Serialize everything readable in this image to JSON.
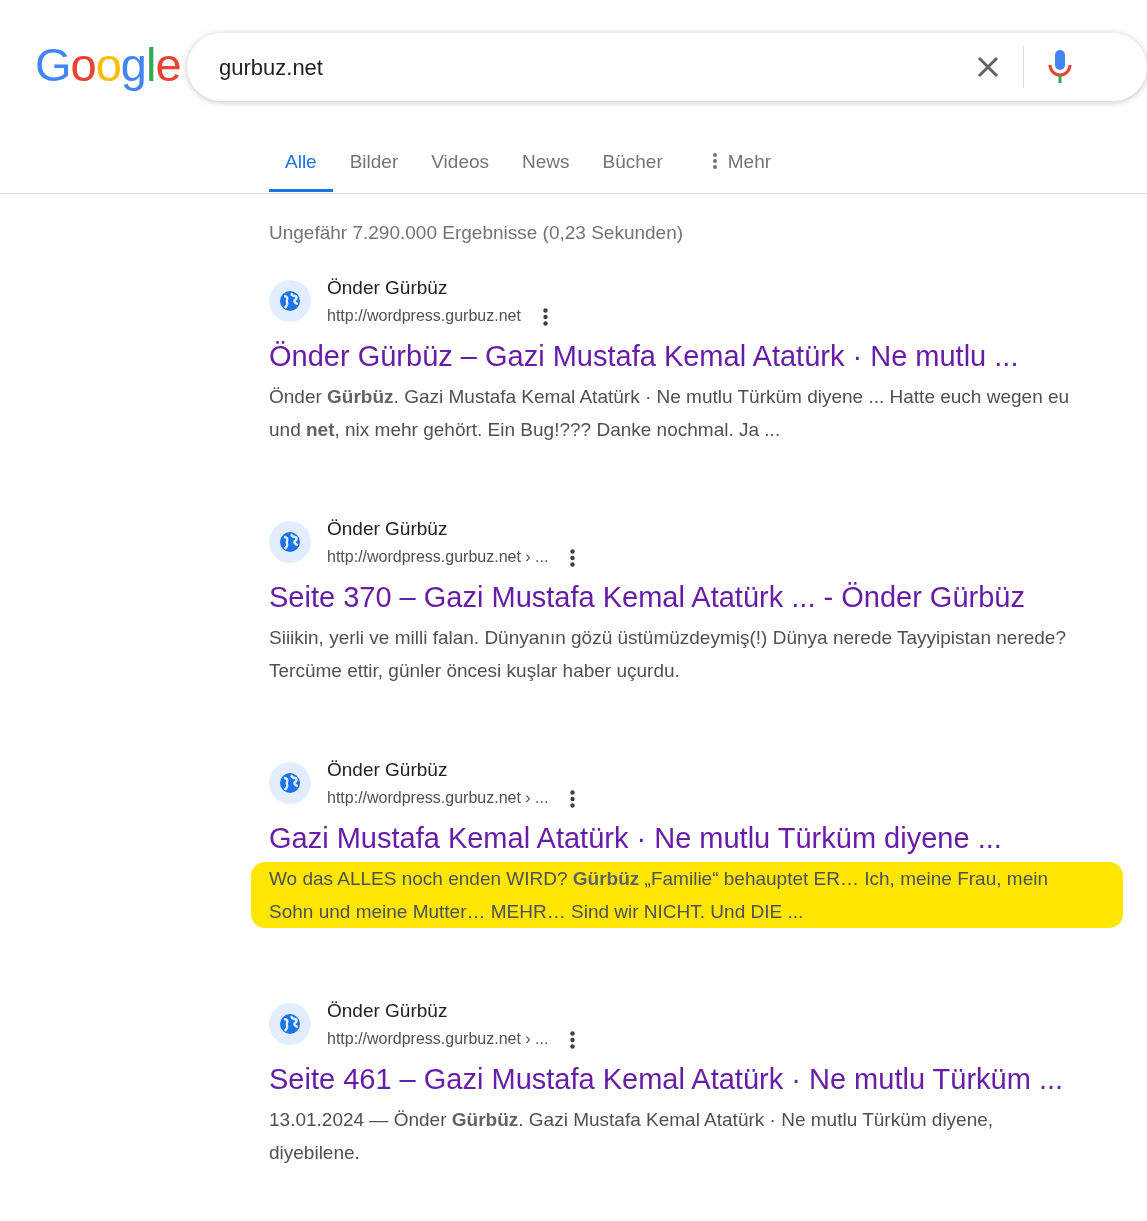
{
  "logo": {
    "letters": [
      {
        "char": "G",
        "color": "#4285f4"
      },
      {
        "char": "o",
        "color": "#ea4335"
      },
      {
        "char": "o",
        "color": "#fbbc05"
      },
      {
        "char": "g",
        "color": "#4285f4"
      },
      {
        "char": "l",
        "color": "#34a853"
      },
      {
        "char": "e",
        "color": "#ea4335"
      }
    ]
  },
  "search": {
    "value": "gurbuz.net"
  },
  "tabs": [
    {
      "label": "Alle",
      "selected": true
    },
    {
      "label": "Bilder",
      "selected": false
    },
    {
      "label": "Videos",
      "selected": false
    },
    {
      "label": "News",
      "selected": false
    },
    {
      "label": "Bücher",
      "selected": false
    },
    {
      "label": "Mehr",
      "selected": false,
      "kind": "more"
    }
  ],
  "result_stats": "Ungefähr 7.290.000 Ergebnisse (0,23 Sekunden)",
  "results": [
    {
      "site": "Önder Gürbüz",
      "url": "http://wordpress.gurbuz.net",
      "title": "Önder Gürbüz – Gazi Mustafa Kemal Atatürk · Ne mutlu ...",
      "snippet_lines": [
        "Önder **Gürbüz**. Gazi Mustafa Kemal Atatürk · Ne mutlu Türküm diyene ... Hatte euch wegen eu",
        "und **net**, nix mehr gehört. Ein Bug!??? Danke nochmal. Ja ..."
      ],
      "highlighted": false
    },
    {
      "site": "Önder Gürbüz",
      "url": "http://wordpress.gurbuz.net › ...",
      "title": "Seite 370 – Gazi Mustafa Kemal Atatürk ... - Önder Gürbüz",
      "snippet_lines": [
        "Siiikin, yerli ve milli falan. Dünyanın gözü üstümüzdeymiş(!) Dünya nerede Tayyipistan nerede?",
        "Tercüme ettir, günler öncesi kuşlar haber uçurdu."
      ],
      "highlighted": false
    },
    {
      "site": "Önder Gürbüz",
      "url": "http://wordpress.gurbuz.net › ...",
      "title": "Gazi Mustafa Kemal Atatürk · Ne mutlu Türküm diyene ...",
      "snippet_lines": [
        "Wo das ALLES noch enden WIRD? **Gürbüz** „Familie“ behauptet ER… Ich, meine Frau, mein",
        "Sohn und meine Mutter… MEHR… Sind wir NICHT. Und DIE ..."
      ],
      "highlighted": true
    },
    {
      "site": "Önder Gürbüz",
      "url": "http://wordpress.gurbuz.net › ...",
      "title": "Seite 461 – Gazi Mustafa Kemal Atatürk · Ne mutlu Türküm ...",
      "snippet_lines": [
        "13.01.2024 — Önder **Gürbüz**. Gazi Mustafa Kemal Atatürk · Ne mutlu Türküm diyene,",
        "diyebilene."
      ],
      "highlighted": false
    }
  ]
}
